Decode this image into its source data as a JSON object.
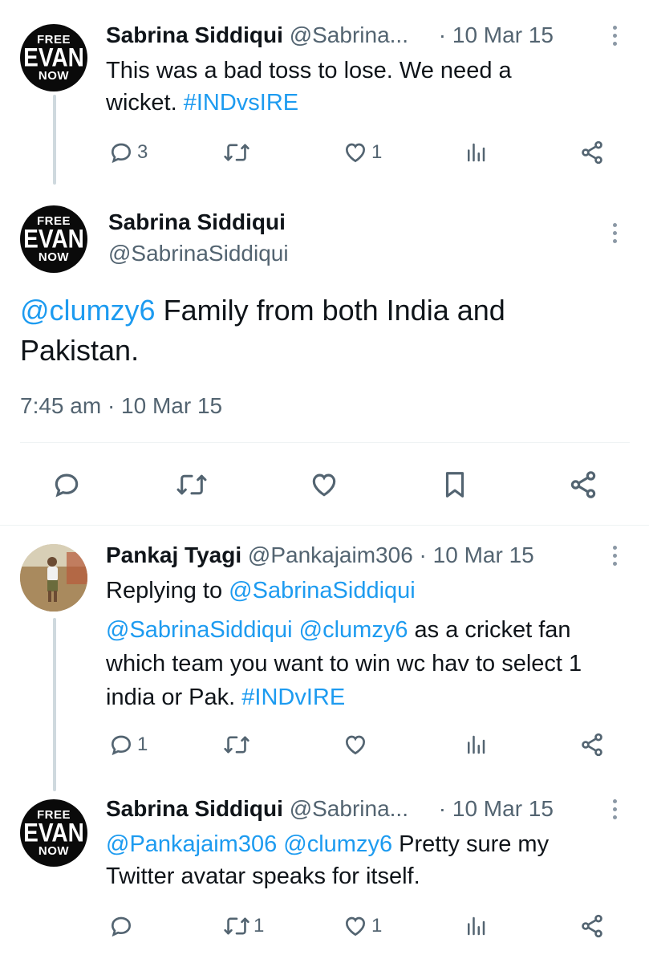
{
  "tweet1": {
    "name": "Sabrina Siddiqui",
    "handle": "@Sabrina...",
    "date": "· 10 Mar 15",
    "text_plain": "This was a bad toss to lose. We need a wicket. ",
    "hashtag": "#INDvsIRE",
    "reply_count": "3",
    "like_count": "1"
  },
  "main": {
    "name": "Sabrina Siddiqui",
    "handle": "@SabrinaSiddiqui",
    "mention": "@clumzy6",
    "text": " Family from both India and Pakistan.",
    "timestamp": "7:45 am · 10 Mar 15"
  },
  "tweet3": {
    "name": "Pankaj Tyagi",
    "handle": "@Pankajaim306",
    "date": "· 10 Mar 15",
    "replying_prefix": "Replying to ",
    "replying_handle": "@SabrinaSiddiqui",
    "mention1": "@SabrinaSiddiqui",
    "mention2": "@clumzy6",
    "text": " as a cricket fan which team you want to win wc hav to select 1 india or Pak. ",
    "hashtag": "#INDvIRE",
    "reply_count": "1"
  },
  "tweet4": {
    "name": "Sabrina Siddiqui",
    "handle": "@Sabrina...",
    "date": "· 10 Mar 15",
    "mention1": "@Pankajaim306",
    "mention2": "@clumzy6",
    "text": " Pretty sure my Twitter avatar speaks for itself.",
    "retweet_count": "1",
    "like_count": "1"
  },
  "avatar": {
    "line1": "FREE",
    "line2": "EVAN",
    "line3": "NOW"
  },
  "icons": {
    "reply": "reply-icon",
    "retweet": "retweet-icon",
    "like": "heart-icon",
    "views": "views-icon",
    "share": "share-icon",
    "bookmark": "bookmark-icon",
    "more": "more-icon"
  },
  "colors": {
    "link": "#1d9bf0",
    "secondary": "#536471",
    "text": "#0f1419",
    "thread_line": "#cfd9de"
  }
}
